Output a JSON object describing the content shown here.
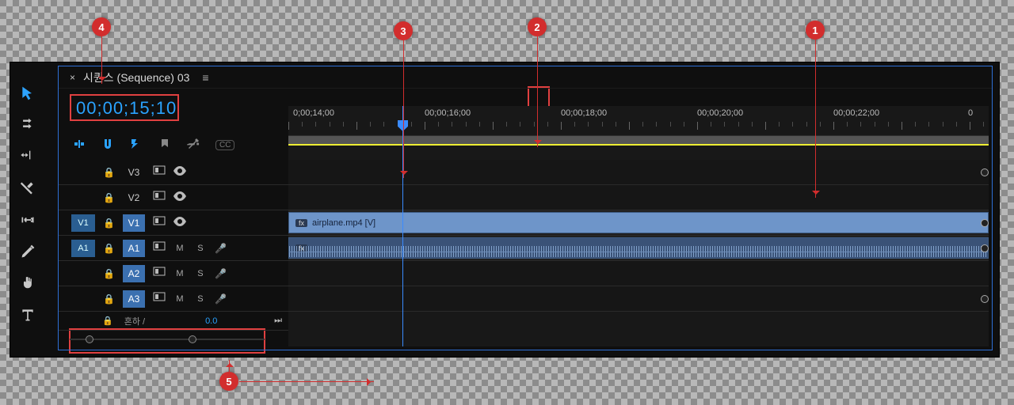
{
  "sequence": {
    "tab_label": "시퀀스 (Sequence) 03",
    "timecode": "00;00;15;10"
  },
  "ruler": {
    "labels": [
      "0;00;14;00",
      "00;00;16;00",
      "00;00;18;00",
      "00;00;20;00",
      "00;00;22;00",
      "0"
    ]
  },
  "tracks": {
    "v3": "V3",
    "v2": "V2",
    "v1": "V1",
    "a1": "A1",
    "a2": "A2",
    "a3": "A3",
    "src_v1": "V1",
    "src_a1": "A1",
    "mix_label": "혼하 /",
    "mix_value": "0.0",
    "mute": "M",
    "solo": "S"
  },
  "clip": {
    "fx": "fx",
    "name": "airplane.mp4 [V]"
  },
  "cc": "CC",
  "callouts": {
    "c1": "1",
    "c2": "2",
    "c3": "3",
    "c4": "4",
    "c5": "5"
  }
}
